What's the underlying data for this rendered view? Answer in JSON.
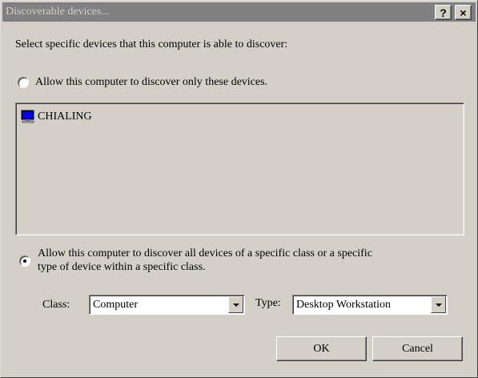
{
  "window": {
    "title": "Discoverable devices...",
    "help_button": "?",
    "close_button": "×"
  },
  "dialog": {
    "instruction": "Select specific devices that this computer is able to discover:",
    "option_only": {
      "label": "Allow this computer to discover only these devices.",
      "selected": false
    },
    "device_list": [
      {
        "name": "CHIALING",
        "icon": "computer-icon"
      }
    ],
    "option_class": {
      "label_line1": "Allow this computer to discover all devices of a specific class or a specific",
      "label_line2": "type of device within a specific class.",
      "selected": true
    },
    "class_label": "Class:",
    "class_value": "Computer",
    "type_label": "Type:",
    "type_value": "Desktop Workstation",
    "ok_label": "OK",
    "cancel_label": "Cancel"
  }
}
